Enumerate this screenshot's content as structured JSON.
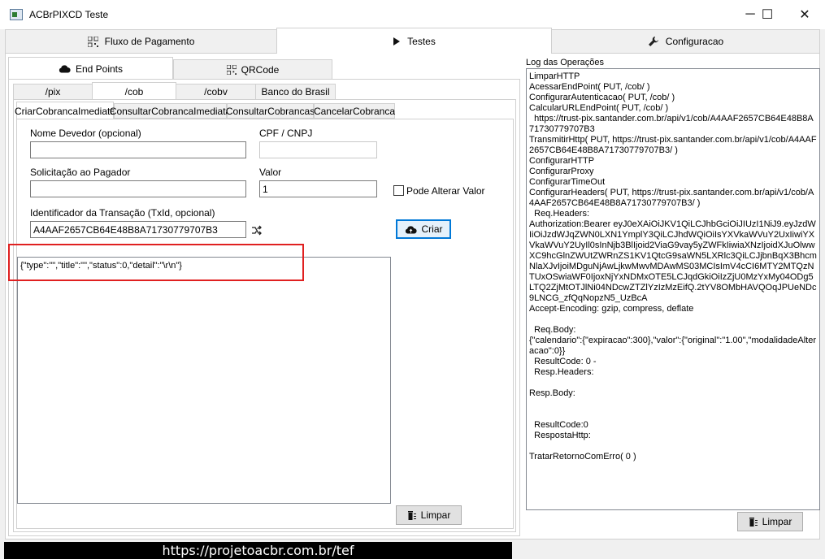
{
  "window": {
    "title": "ACBrPIXCD Teste",
    "minimize": "─",
    "maximize": "☐",
    "close": "✕"
  },
  "main_tabs": [
    {
      "label": "Fluxo de Pagamento",
      "icon": "qrcode-icon"
    },
    {
      "label": "Testes",
      "icon": "play-icon"
    },
    {
      "label": "Configuracao",
      "icon": "wrench-icon"
    }
  ],
  "sub_tabs": [
    {
      "label": "End Points",
      "icon": "cloud-icon"
    },
    {
      "label": "QRCode",
      "icon": "qrcode-icon"
    }
  ],
  "endpoint_tabs": [
    "/pix",
    "/cob",
    "/cobv",
    "Banco do Brasil"
  ],
  "cob_tabs": [
    "CriarCobrancaImediata",
    "ConsultarCobrancaImediata",
    "ConsultarCobrancas",
    "CancelarCobranca"
  ],
  "form": {
    "nome_devedor_label": "Nome Devedor (opcional)",
    "nome_devedor_value": "",
    "cpf_cnpj_label": "CPF / CNPJ",
    "cpf_cnpj_value": "",
    "solicitacao_label": "Solicitação ao Pagador",
    "solicitacao_value": "",
    "valor_label": "Valor",
    "valor_value": "1",
    "pode_alterar_label": "Pode Alterar Valor",
    "txid_label": "Identificador da Transação (TxId, opcional)",
    "txid_value": "A4AAF2657CB64E48B8A71730779707B3",
    "criar_label": "Criar",
    "result_text": "{\"type\":\"\",\"title\":\"\",\"status\":0,\"detail\":\"\\r\\n\"}",
    "limpar_label": "Limpar"
  },
  "log": {
    "title": "Log das Operações",
    "text": "LimparHTTP\nAcessarEndPoint( PUT, /cob/ )\nConfigurarAutenticacao( PUT, /cob/ )\nCalcularURLEndPoint( PUT, /cob/ )\n  https://trust-pix.santander.com.br/api/v1/cob/A4AAF2657CB64E48B8A71730779707B3\nTransmitirHttp( PUT, https://trust-pix.santander.com.br/api/v1/cob/A4AAF2657CB64E48B8A71730779707B3/ )\nConfigurarHTTP\nConfigurarProxy\nConfigurarTimeOut\nConfigurarHeaders( PUT, https://trust-pix.santander.com.br/api/v1/cob/A4AAF2657CB64E48B8A71730779707B3/ )\n  Req.Headers:\nAuthorization:Bearer eyJ0eXAiOiJKV1QiLCJhbGciOiJIUzI1NiJ9.eyJzdWIiOiJzdWJqZWN0LXN1YmplY3QiLCJhdWQiOiIsYXVkaWVuY2UxIiwiYXVkaWVuY2UyIl0sInNjb3BlIjoid2ViaG9vay5yZWFkIiwiaXNzIjoidXJuOlwwXC9hcGlnZWUtZWRnZS1KV1QtcG9saWN5LXRlc3QiLCJjbnBqX3BhcmNlaXJvIjoiMDguNjAwLjkwMwvMDAwMS03MCIsImV4cCI6MTY2MTQzNTUxOSwiaWF0IjoxNjYxNDMxOTE5LCJqdGkiOiIzZjU0MzYxMy04ODg5LTQ2ZjMtOTJlNi04NDcwZTZlYzIzMzEifQ.2tYV8OMbHAVQOqJPUeNDc9LNCG_zfQqNopzN5_UzBcA\nAccept-Encoding: gzip, compress, deflate\n\n  Req.Body:\n{\"calendario\":{\"expiracao\":300},\"valor\":{\"original\":\"1.00\",\"modalidadeAlteracao\":0}}\n  ResultCode: 0 -\n  Resp.Headers:\n\nResp.Body:\n\n\n  ResultCode:0\n  RespostaHttp:\n\nTratarRetornoComErro( 0 )",
    "limpar_label": "Limpar"
  },
  "footer": {
    "url": "https://projetoacbr.com.br/tef"
  },
  "colors": {
    "highlight": "#e02020",
    "focus": "#0078d7"
  }
}
